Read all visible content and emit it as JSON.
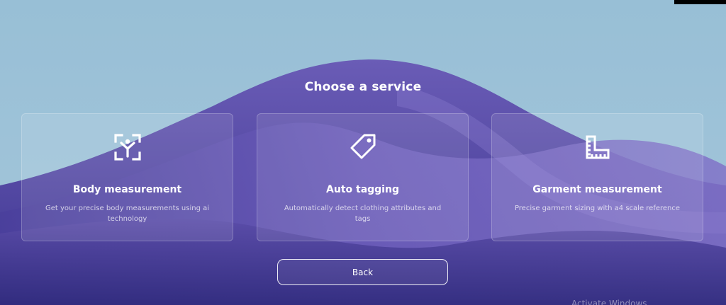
{
  "page": {
    "title": "Choose a service"
  },
  "cards": [
    {
      "title": "Body measurement",
      "description": "Get your precise body measurements using ai technology",
      "icon": "body-scan-icon"
    },
    {
      "title": "Auto tagging",
      "description": "Automatically detect clothing attributes and tags",
      "icon": "tag-icon"
    },
    {
      "title": "Garment measurement",
      "description": "Precise garment sizing with a4 scale reference",
      "icon": "ruler-square-icon"
    }
  ],
  "actions": {
    "back_label": "Back"
  },
  "watermark": {
    "text": "Activate Windows"
  },
  "colors": {
    "sky": "#9cc0d6",
    "hill_dark": "#3f3690",
    "hill_light": "#7a6cc2",
    "text": "#ffffff"
  }
}
